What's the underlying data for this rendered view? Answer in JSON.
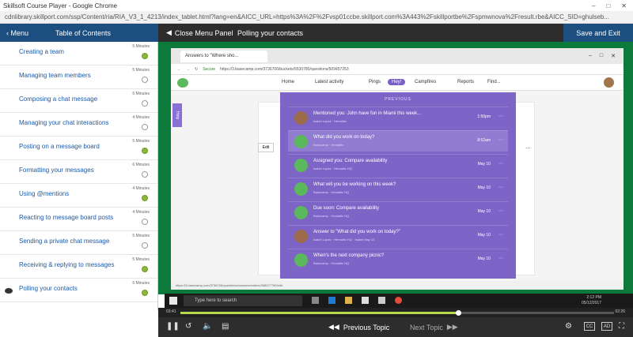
{
  "browser": {
    "title": "Skillsoft Course Player - Google Chrome",
    "url": "cdnlibrary.skillport.com/ssp/Content/ria/RIA_V3_1_4213/index_tablet.html?lang=en&AICC_URL=https%3A%2F%2Fvsp01ccbe.skillport.com%3A443%2Fskillportbe%2Fspmwnova%2Fresult.rbe&AICC_SID=ghulseb..."
  },
  "topbar": {
    "menu_label": "Menu",
    "toc_label": "Table of Contents",
    "close_panel_label": "Close Menu Panel",
    "current_title": "Polling your contacts",
    "save_exit_label": "Save and Exit"
  },
  "sidebar": {
    "items": [
      {
        "label": "Creating a team",
        "duration": "5 Minutes",
        "done": true
      },
      {
        "label": "Managing team members",
        "duration": "5 Minutes",
        "done": false
      },
      {
        "label": "Composing a chat message",
        "duration": "5 Minutes",
        "done": false
      },
      {
        "label": "Managing your chat interactions",
        "duration": "4 Minutes",
        "done": false
      },
      {
        "label": "Posting on a message board",
        "duration": "5 Minutes",
        "done": true
      },
      {
        "label": "Formatting your messages",
        "duration": "6 Minutes",
        "done": false
      },
      {
        "label": "Using @mentions",
        "duration": "4 Minutes",
        "done": true
      },
      {
        "label": "Reacting to message board posts",
        "duration": "4 Minutes",
        "done": false
      },
      {
        "label": "Sending a private chat message",
        "duration": "5 Minutes",
        "done": false
      },
      {
        "label": "Receiving & replying to messages",
        "duration": "5 Minutes",
        "done": true
      },
      {
        "label": "Polling your contacts",
        "duration": "5 Minutes",
        "done": true
      }
    ]
  },
  "screen": {
    "tab_label": "Answers to \"Where sho...",
    "url_secure": "Secure",
    "url": "https://3.basecamp.com/3736706/buckets/5530780/questions/509457253",
    "nav": {
      "home": "Home",
      "activity": "Latest activity",
      "pings": "Pings",
      "hey": "Hey!",
      "campfires": "Campfires",
      "reports": "Reports",
      "find": "Find..."
    },
    "help_tab": "Help",
    "edit_label": "Edit",
    "status_url": "https://3.basecamp.com/3736706/questions/answers/entries/398077760/edit",
    "hey_panel": {
      "heading": "PREVIOUS",
      "rows": [
        {
          "title": "Mentioned you: John have fun in Miami this week...",
          "sub": "Isabel Lopez · Hemaltic",
          "date": "1:50pm",
          "avatar": "person"
        },
        {
          "title": "What did you work on today?",
          "sub": "Basecamp · Hemaltic",
          "date": "8:52am",
          "avatar": "basecamp"
        },
        {
          "title": "Assigned you: Compare availability",
          "sub": "Isabel Lopez · Hemaltic HQ",
          "date": "May 10",
          "avatar": "basecamp"
        },
        {
          "title": "What will you be working on this week?",
          "sub": "Basecamp · Hemaltic HQ",
          "date": "May 10",
          "avatar": "basecamp"
        },
        {
          "title": "Due soon: Compare availability",
          "sub": "Basecamp · Hemaltic HQ",
          "date": "May 10",
          "avatar": "basecamp"
        },
        {
          "title": "Answer to \"What did you work on today?\"",
          "sub": "Isabel Lopez · Hemaltic HQ · Isabel May 10",
          "date": "May 10",
          "avatar": "person"
        },
        {
          "title": "When's the next company picnic?",
          "sub": "Basecamp · Hemaltic HQ",
          "date": "May 10",
          "avatar": "basecamp"
        }
      ]
    }
  },
  "taskbar": {
    "search_placeholder": "Type here to search",
    "time": "2:12 PM",
    "date": "05/12/2017"
  },
  "player": {
    "elapsed": "03:41",
    "total": "02:26",
    "progress_fraction": 0.64,
    "prev_topic": "Previous Topic",
    "next_topic": "Next Topic",
    "cc_label": "CC",
    "ad_label": "AD"
  },
  "colors": {
    "accent_blue": "#1c4e80",
    "hey_purple": "#7d65c8",
    "done_green": "#8cb63c",
    "stage_green": "#0b7a3a"
  }
}
